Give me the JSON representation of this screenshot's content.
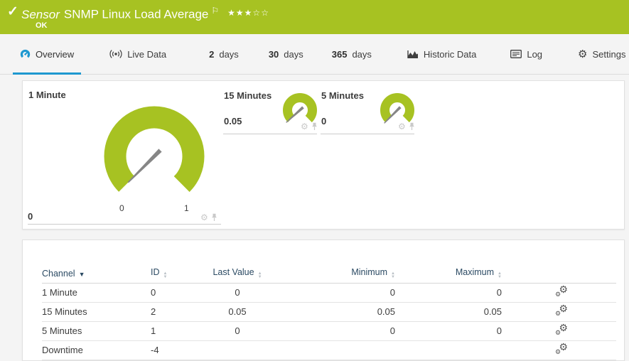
{
  "header": {
    "check_icon": "✓",
    "type_label": "Sensor",
    "title": "SNMP Linux Load Average",
    "flag_icon": "⚐",
    "stars": "★★★☆☆",
    "status": "OK"
  },
  "tabs": [
    {
      "label": "Overview",
      "active": true
    },
    {
      "label": "Live Data"
    },
    {
      "strong": "2",
      "label": "days"
    },
    {
      "strong": "30",
      "label": "days"
    },
    {
      "strong": "365",
      "label": "days"
    },
    {
      "label": "Historic Data"
    },
    {
      "label": "Log"
    },
    {
      "label": "Settings"
    }
  ],
  "gauges": {
    "primary": {
      "name": "1 Minute",
      "value": "0",
      "scale_min": "0",
      "scale_max": "1"
    },
    "secondary": [
      {
        "name": "15 Minutes",
        "value": "0.05"
      },
      {
        "name": "5 Minutes",
        "value": "0"
      }
    ],
    "gear_glyph": "⚙"
  },
  "table": {
    "columns": [
      "Channel",
      "ID",
      "Last Value",
      "Minimum",
      "Maximum"
    ],
    "rows": [
      {
        "channel": "1 Minute",
        "id": "0",
        "last": "0",
        "min": "0",
        "max": "0"
      },
      {
        "channel": "15 Minutes",
        "id": "2",
        "last": "0.05",
        "min": "0.05",
        "max": "0.05"
      },
      {
        "channel": "5 Minutes",
        "id": "1",
        "last": "0",
        "min": "0",
        "max": "0"
      },
      {
        "channel": "Downtime",
        "id": "-4",
        "last": "",
        "min": "",
        "max": ""
      }
    ]
  },
  "colors": {
    "status_green": "#a7c222",
    "accent_blue": "#1e98d0",
    "needle_gray": "#868686",
    "header_text_blue": "#2b4a63"
  }
}
